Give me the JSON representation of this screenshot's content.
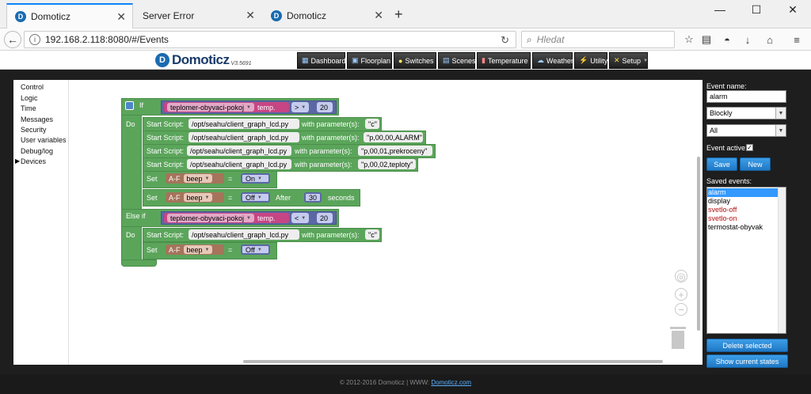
{
  "browser": {
    "tabs": [
      {
        "label": "Domoticz"
      },
      {
        "label": "Server Error"
      },
      {
        "label": "Domoticz"
      }
    ],
    "url": "192.168.2.118:8080/#/Events",
    "search_placeholder": "Hledat"
  },
  "header": {
    "logo_text": "Domoticz",
    "logo_version": "V3.5691",
    "menu": [
      {
        "label": "Dashboard",
        "icon": "dashboard-icon"
      },
      {
        "label": "Floorplan",
        "icon": "floorplan-icon"
      },
      {
        "label": "Switches",
        "icon": "bulb-icon"
      },
      {
        "label": "Scenes",
        "icon": "scenes-icon"
      },
      {
        "label": "Temperature",
        "icon": "thermometer-icon"
      },
      {
        "label": "Weather",
        "icon": "cloud-icon"
      },
      {
        "label": "Utility",
        "icon": "utility-icon"
      },
      {
        "label": "Setup",
        "icon": "wrench-icon"
      }
    ]
  },
  "categories": [
    "Control",
    "Logic",
    "Time",
    "Messages",
    "Security",
    "User variables",
    "Debug/log",
    "Devices"
  ],
  "blocks": {
    "if_label": "If",
    "do_label": "Do",
    "elseif_label": "Else if",
    "start_script": "Start Script:",
    "with_params": "with parameter(s):",
    "set_label": "Set",
    "after_label": "After",
    "seconds_label": "seconds",
    "device1": "teplomer-obyvaci-pokoj",
    "temp_label": "temp.",
    "op_gt": ">",
    "op_lt": "<",
    "val20": "20",
    "script_path": "/opt/seahu/client_graph_lcd.py",
    "params": [
      "\"c\"",
      "\"p,00,00,ALARM\"",
      "\"p,00,01,prekroceny\"",
      "\"p,00,02,teploty\""
    ],
    "af_label": "A-F",
    "beep": "beep",
    "eq": "=",
    "on": "On",
    "off": "Off",
    "val30": "30",
    "param_c2": "\"c\""
  },
  "right_panel": {
    "event_name_label": "Event name:",
    "event_name_value": "alarm",
    "type_value": "Blockly",
    "trigger_value": "All",
    "event_active_label": "Event active:",
    "save_label": "Save",
    "new_label": "New",
    "saved_events_label": "Saved events:",
    "saved_events": [
      {
        "name": "alarm",
        "color": "#ffffff",
        "selected": true
      },
      {
        "name": "display",
        "color": "#000000"
      },
      {
        "name": "svetlo-off",
        "color": "#b01010"
      },
      {
        "name": "svetlo-on",
        "color": "#b01010"
      },
      {
        "name": "termostat-obyvak",
        "color": "#000000"
      }
    ],
    "delete_label": "Delete selected",
    "show_states_label": "Show current states"
  },
  "footer": {
    "text": "© 2012-2016 Domoticz | WWW:",
    "link": "Domoticz.com"
  }
}
